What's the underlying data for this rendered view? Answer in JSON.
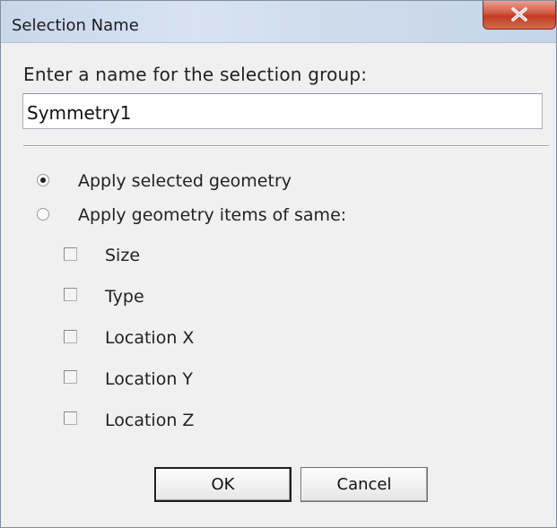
{
  "window": {
    "title": "Selection Name"
  },
  "dialog": {
    "prompt": "Enter a name for the selection group:",
    "name_value": "Symmetry1",
    "radio_options": [
      {
        "label": "Apply selected geometry",
        "selected": true
      },
      {
        "label": "Apply geometry items of same:",
        "selected": false
      }
    ],
    "checkboxes": [
      {
        "label": "Size",
        "checked": false
      },
      {
        "label": "Type",
        "checked": false
      },
      {
        "label": "Location X",
        "checked": false
      },
      {
        "label": "Location Y",
        "checked": false
      },
      {
        "label": "Location Z",
        "checked": false
      }
    ],
    "ok_label": "OK",
    "cancel_label": "Cancel"
  },
  "icons": {
    "close": "close-icon"
  },
  "colors": {
    "title_bar": "#cfdcec",
    "close_button": "#c94a32",
    "dialog_background": "#f0f0f0"
  }
}
